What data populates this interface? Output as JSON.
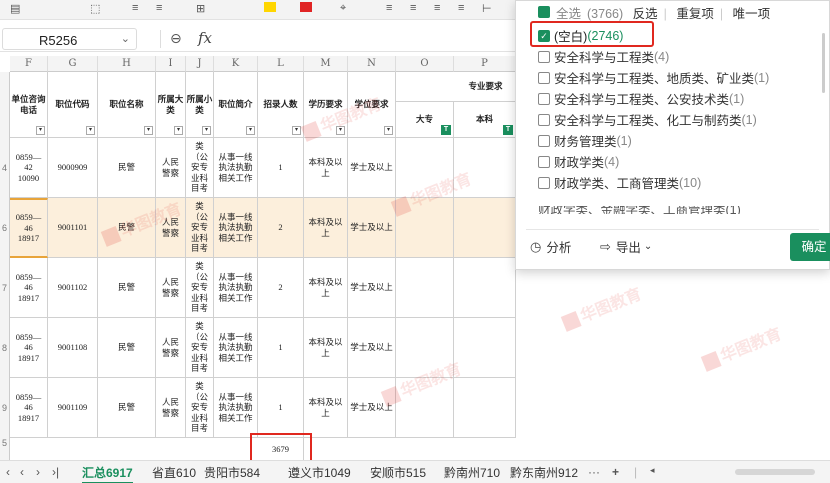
{
  "formula_bar": {
    "cell_ref": "R5256",
    "fx": "fx"
  },
  "columns": {
    "letters": [
      "F",
      "G",
      "H",
      "I",
      "J",
      "K",
      "L",
      "M",
      "N",
      "O",
      "P"
    ],
    "headers": {
      "unit_phone": "单位咨询电话",
      "job_code": "职位代码",
      "job_name": "职位名称",
      "category_big": "所属大类",
      "category_small": "所属小类",
      "job_intro": "职位简介",
      "recruit_num": "招录人数",
      "edu_req": "学历要求",
      "degree_req": "学位要求",
      "major_req": "专业要求",
      "dazhuan": "大专",
      "benke": "本科"
    }
  },
  "rows": [
    {
      "num": "4",
      "phone": "0859—42\n10090",
      "code": "9000909",
      "name": "民警",
      "big": "人民警察",
      "small": "类（公安专业科目考",
      "intro": "从事一线执法执勤相关工作",
      "count": "1",
      "edu": "本科及以上",
      "degree": "学士及以上"
    },
    {
      "num": "6",
      "phone": "0859—46\n18917",
      "code": "9001101",
      "name": "民警",
      "big": "人民警察",
      "small": "类（公安专业科目考",
      "intro": "从事一线执法执勤相关工作",
      "count": "2",
      "edu": "本科及以上",
      "degree": "学士及以上"
    },
    {
      "num": "7",
      "phone": "0859—46\n18917",
      "code": "9001102",
      "name": "民警",
      "big": "人民警察",
      "small": "类（公安专业科目考",
      "intro": "从事一线执法执勤相关工作",
      "count": "2",
      "edu": "本科及以上",
      "degree": "学士及以上"
    },
    {
      "num": "8",
      "phone": "0859—46\n18917",
      "code": "9001108",
      "name": "民警",
      "big": "人民警察",
      "small": "类（公安专业科目考",
      "intro": "从事一线执法执勤相关工作",
      "count": "1",
      "edu": "本科及以上",
      "degree": "学士及以上"
    },
    {
      "num": "9",
      "phone": "0859—46\n18917",
      "code": "9001109",
      "name": "民警",
      "big": "人民警察",
      "small": "类（公安专业科目考",
      "intro": "从事一线执法执勤相关工作",
      "count": "1",
      "edu": "本科及以上",
      "degree": "学士及以上"
    }
  ],
  "status": {
    "row_num": "5",
    "sum_value": "3679"
  },
  "sheet_tabs": [
    "汇总6917",
    "省直610",
    "贵阳市584",
    "遵义市1049",
    "安顺市515",
    "黔南州710",
    "黔东南州912"
  ],
  "sheet_nav": {
    "first": "|<",
    "prev": "<",
    "next": ">",
    "last": ">|",
    "more": "···",
    "add": "+"
  },
  "filter_popup": {
    "select_all": "全选",
    "select_all_count": "(3766)",
    "invert": "反选",
    "duplicates": "重复项",
    "unique": "唯一项",
    "options": [
      {
        "label": "(空白)",
        "count": "(2746)",
        "checked": true
      },
      {
        "label": "安全科学与工程类",
        "count": "(4)",
        "checked": false
      },
      {
        "label": "安全科学与工程类、地质类、矿业类",
        "count": "(1)",
        "checked": false
      },
      {
        "label": "安全科学与工程类、公安技术类",
        "count": "(1)",
        "checked": false
      },
      {
        "label": "安全科学与工程类、化工与制药类",
        "count": "(1)",
        "checked": false
      },
      {
        "label": "财务管理类",
        "count": "(1)",
        "checked": false
      },
      {
        "label": "财政学类",
        "count": "(4)",
        "checked": false
      },
      {
        "label": "财政学类、工商管理类",
        "count": "(10)",
        "checked": false
      }
    ],
    "partial_option": "财政学类、金融学类、工商管理类(1)",
    "analyze": "分析",
    "export": "导出",
    "confirm": "确定"
  },
  "watermark": "华图教育",
  "colors": {
    "accent": "#1a8f5e",
    "highlight_box": "#e0281f",
    "row_highlight": "#fcefdc"
  }
}
